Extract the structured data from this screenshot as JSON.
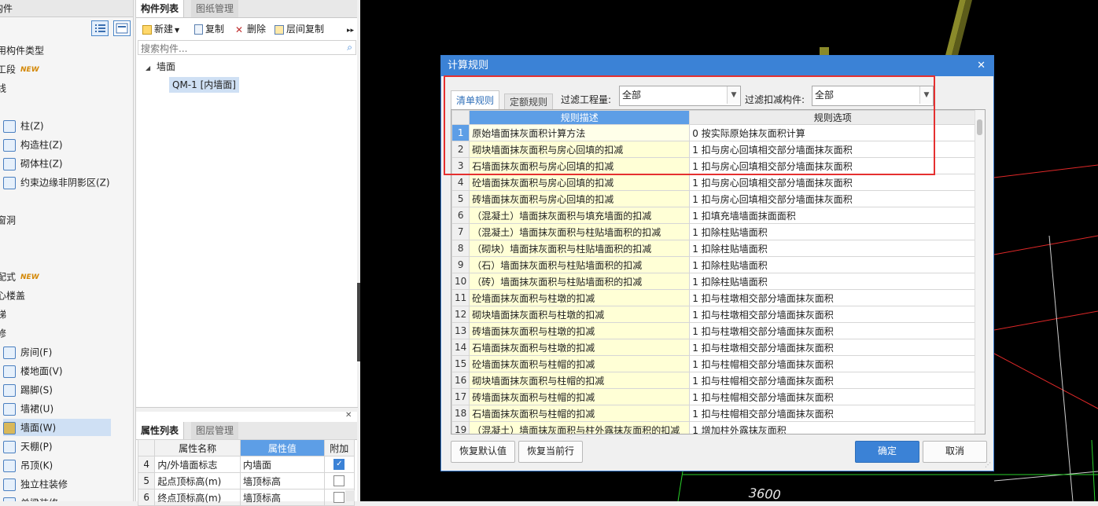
{
  "left_panel": {
    "title_partial": "构件",
    "items": [
      {
        "label": "用构件类型",
        "icon": "none"
      },
      {
        "label": "工段",
        "icon": "none",
        "badge": "NEW"
      },
      {
        "label": "线",
        "icon": "none"
      },
      {
        "label": "柱(Z)",
        "icon": "column-icon"
      },
      {
        "label": "构造柱(Z)",
        "icon": "constructional-column-icon"
      },
      {
        "label": "砌体柱(Z)",
        "icon": "masonry-column-icon"
      },
      {
        "label": "约束边缘非阴影区(Z)",
        "icon": "constraint-edge-icon"
      },
      {
        "label": "窗洞",
        "icon": "none"
      },
      {
        "label": "配式",
        "icon": "none",
        "badge": "NEW"
      },
      {
        "label": "心楼盖",
        "icon": "none"
      },
      {
        "label": "梯",
        "icon": "none"
      },
      {
        "label": "修",
        "icon": "none"
      },
      {
        "label": "房间(F)",
        "icon": "room-icon"
      },
      {
        "label": "楼地面(V)",
        "icon": "floor-icon"
      },
      {
        "label": "踢脚(S)",
        "icon": "skirting-icon"
      },
      {
        "label": "墙裙(U)",
        "icon": "dado-icon"
      },
      {
        "label": "墙面(W)",
        "icon": "wall-surface-icon",
        "selected": true
      },
      {
        "label": "天棚(P)",
        "icon": "ceiling-icon"
      },
      {
        "label": "吊顶(K)",
        "icon": "suspended-ceiling-icon"
      },
      {
        "label": "独立柱装修",
        "icon": "column-finish-icon"
      },
      {
        "label": "单梁装修",
        "icon": "beam-finish-icon"
      }
    ]
  },
  "component_panel": {
    "tabs": [
      "构件列表",
      "图纸管理"
    ],
    "toolbar": {
      "new": "新建",
      "copy": "复制",
      "delete": "删除",
      "floor_copy": "层间复制"
    },
    "search_placeholder": "搜索构件...",
    "tree_root": "墙面",
    "tree_child": "QM-1 [内墙面]"
  },
  "property_panel": {
    "tabs": [
      "属性列表",
      "图层管理"
    ],
    "headers": [
      "属性名称",
      "属性值",
      "附加"
    ],
    "rows": [
      {
        "num": "4",
        "name": "内/外墙面标志",
        "value": "内墙面",
        "checked": true
      },
      {
        "num": "5",
        "name": "起点顶标高(m)",
        "value": "墙顶标高",
        "checked": false
      },
      {
        "num": "6",
        "name": "终点顶标高(m)",
        "value": "墙顶标高",
        "checked": false
      }
    ]
  },
  "canvas": {
    "dimension_label": "3600"
  },
  "dialog": {
    "title": "计算规则",
    "tabs": [
      "清单规则",
      "定额规则"
    ],
    "filter_quantity_label": "过滤工程量:",
    "filter_quantity_value": "全部",
    "filter_deduct_label": "过滤扣减构件:",
    "filter_deduct_value": "全部",
    "columns": [
      "规则描述",
      "规则选项"
    ],
    "rows": [
      {
        "num": "1",
        "desc": "原始墙面抹灰面积计算方法",
        "option": "0 按实际原始抹灰面积计算"
      },
      {
        "num": "2",
        "desc": "砌块墙面抹灰面积与房心回填的扣减",
        "option": "1 扣与房心回填相交部分墙面抹灰面积"
      },
      {
        "num": "3",
        "desc": "石墙面抹灰面积与房心回填的扣减",
        "option": "1 扣与房心回填相交部分墙面抹灰面积"
      },
      {
        "num": "4",
        "desc": "砼墙面抹灰面积与房心回填的扣减",
        "option": "1 扣与房心回填相交部分墙面抹灰面积"
      },
      {
        "num": "5",
        "desc": "砖墙面抹灰面积与房心回填的扣减",
        "option": "1 扣与房心回填相交部分墙面抹灰面积"
      },
      {
        "num": "6",
        "desc": "（混凝土）墙面抹灰面积与填充墙面的扣减",
        "option": "1 扣填充墙墙面抹面面积"
      },
      {
        "num": "7",
        "desc": "（混凝土）墙面抹灰面积与柱贴墙面积的扣减",
        "option": "1 扣除柱贴墙面积"
      },
      {
        "num": "8",
        "desc": "（砌块）墙面抹灰面积与柱贴墙面积的扣减",
        "option": "1 扣除柱贴墙面积"
      },
      {
        "num": "9",
        "desc": "（石）墙面抹灰面积与柱贴墙面积的扣减",
        "option": "1 扣除柱贴墙面积"
      },
      {
        "num": "10",
        "desc": "（砖）墙面抹灰面积与柱贴墙面积的扣减",
        "option": "1 扣除柱贴墙面积"
      },
      {
        "num": "11",
        "desc": "砼墙面抹灰面积与柱墩的扣减",
        "option": "1 扣与柱墩相交部分墙面抹灰面积"
      },
      {
        "num": "12",
        "desc": "砌块墙面抹灰面积与柱墩的扣减",
        "option": "1 扣与柱墩相交部分墙面抹灰面积"
      },
      {
        "num": "13",
        "desc": "砖墙面抹灰面积与柱墩的扣减",
        "option": "1 扣与柱墩相交部分墙面抹灰面积"
      },
      {
        "num": "14",
        "desc": "石墙面抹灰面积与柱墩的扣减",
        "option": "1 扣与柱墩相交部分墙面抹灰面积"
      },
      {
        "num": "15",
        "desc": "砼墙面抹灰面积与柱帽的扣减",
        "option": "1 扣与柱帽相交部分墙面抹灰面积"
      },
      {
        "num": "16",
        "desc": "砌块墙面抹灰面积与柱帽的扣减",
        "option": "1 扣与柱帽相交部分墙面抹灰面积"
      },
      {
        "num": "17",
        "desc": "砖墙面抹灰面积与柱帽的扣减",
        "option": "1 扣与柱帽相交部分墙面抹灰面积"
      },
      {
        "num": "18",
        "desc": "石墙面抹灰面积与柱帽的扣减",
        "option": "1 扣与柱帽相交部分墙面抹灰面积"
      },
      {
        "num": "19",
        "desc": "（混凝土）墙面抹灰面积与柱外露抹灰面积的扣减",
        "option": "1 增加柱外露抹灰面积"
      }
    ],
    "buttons": {
      "restore_default": "恢复默认值",
      "restore_row": "恢复当前行",
      "ok": "确定",
      "cancel": "取消"
    }
  },
  "colors": {
    "accent": "#3b82d6",
    "highlight": "#e53030",
    "desc_cell": "#ffffd6"
  }
}
